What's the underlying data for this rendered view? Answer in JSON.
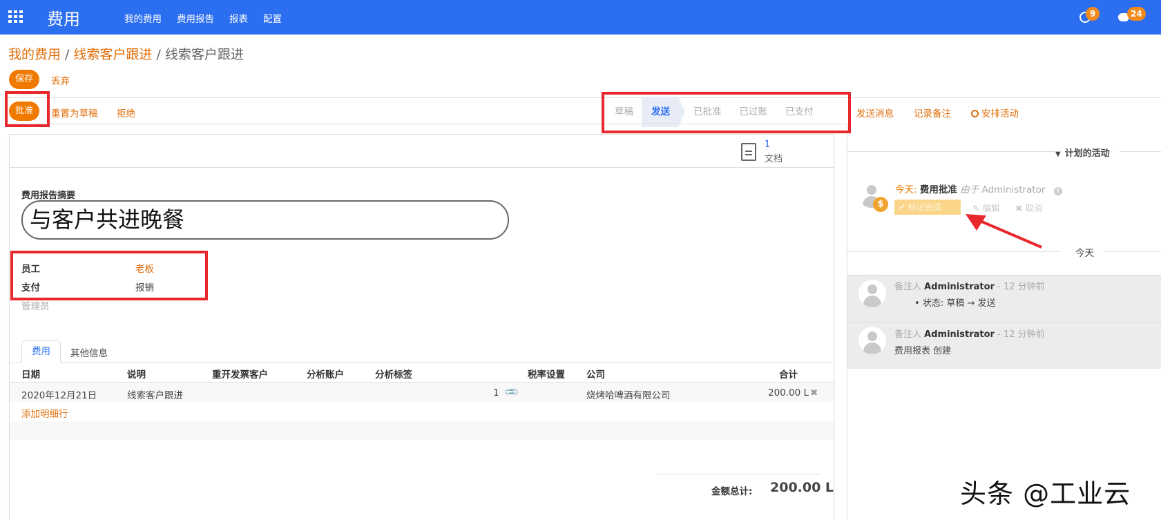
{
  "nav": {
    "brand": "费用",
    "menu": [
      "我的费用",
      "费用报告",
      "报表",
      "配置"
    ],
    "activity_count": "9",
    "message_count": "24"
  },
  "breadcrumb": {
    "level1": "我的费用",
    "level2": "线索客户跟进",
    "current": "线索客户跟进"
  },
  "actions": {
    "save": "保存",
    "discard": "丢弃",
    "approve": "批准",
    "reset_draft": "重置为草稿",
    "refuse": "拒绝"
  },
  "status_steps": [
    "草稿",
    "发送",
    "已批准",
    "已过账",
    "已支付"
  ],
  "status_active": "发送",
  "chatter_actions": {
    "send_message": "发送消息",
    "log_note": "记录备注",
    "schedule_activity": "安排活动"
  },
  "smart_button": {
    "count": "1",
    "label": "文档"
  },
  "form": {
    "summary_label": "费用报告摘要",
    "summary_value": "与客户共进晚餐",
    "employee_label": "员工",
    "employee_value": "老板",
    "payment_label": "支付",
    "payment_value": "报销",
    "manager_placeholder": "管理员"
  },
  "tabs": [
    "费用",
    "其他信息"
  ],
  "table": {
    "headers": [
      "日期",
      "说明",
      "重开发票客户",
      "分析账户",
      "分析标签",
      "税率设置",
      "公司",
      "合计"
    ],
    "rows": [
      {
        "date": "2020年12月21日",
        "description": "线索客户跟进",
        "attachments": "1",
        "company": "烧烤哈啤酒有限公司",
        "total": "200.00 L"
      }
    ],
    "add_line": "添加明细行"
  },
  "totals": {
    "label": "金额总计:",
    "value": "200.00 L"
  },
  "activities": {
    "section_title": "计划的活动",
    "today_prefix": "今天:",
    "activity_title": "费用批准",
    "by_text": "由于",
    "assignee": "Administrator",
    "mark_done": "标记完成",
    "edit": "编辑",
    "cancel": "取消"
  },
  "today_divider": "今天",
  "messages": [
    {
      "type": "备注人",
      "author": "Administrator",
      "time": "- 12 分钟前",
      "body_bullet": "状态: 草稿 → 发送"
    },
    {
      "type": "备注人",
      "author": "Administrator",
      "time": "- 12 分钟前",
      "body": "费用报表 创建"
    }
  ],
  "watermark": "头条 @工业云",
  "colors": {
    "nav": "#2c6ef0",
    "accent": "#f07900",
    "link": "#e06f0b",
    "highlight_box": "#e8282d"
  }
}
